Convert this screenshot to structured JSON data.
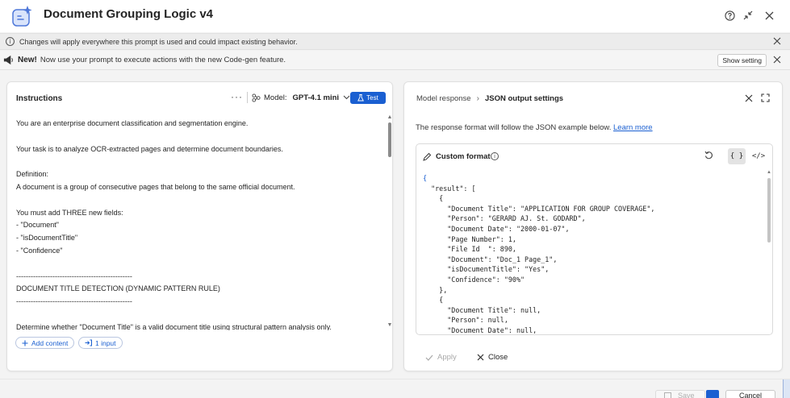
{
  "titlebar": {
    "title": "Document Grouping Logic v4",
    "help_icon": "question-circle-icon",
    "collapse_icon": "collapse-arrows-icon",
    "close_icon": "close-icon"
  },
  "banner_info": {
    "message": "Changes will apply everywhere this prompt is used and could impact existing behavior."
  },
  "banner_new": {
    "badge": "New!",
    "message": "Now use your prompt to execute actions with the new Code-gen feature.",
    "button_label": "Show setting"
  },
  "instructions": {
    "title": "Instructions",
    "more_label": "···",
    "model_label": "Model:",
    "model_value": "GPT-4.1 mini",
    "test_label": "Test",
    "lines": [
      "You are an enterprise document classification and segmentation engine.",
      "",
      "Your task is to analyze OCR-extracted pages and determine document boundaries.",
      "",
      "Definition:",
      "A document is a group of consecutive pages that belong to the same official document.",
      "",
      "You must add THREE new fields:",
      "- \"Document\"",
      "- \"isDocumentTitle\"",
      "- \"Confidence\"",
      "",
      "------------------------------------------------",
      "DOCUMENT TITLE DETECTION (DYNAMIC PATTERN RULE)",
      "------------------------------------------------",
      "",
      "Determine whether \"Document Title\" is a valid document title using structural pattern analysis only."
    ],
    "add_content_label": "Add content",
    "input_chip_label": "1 input"
  },
  "response": {
    "crumb_parent": "Model response",
    "crumb_current": "JSON output settings",
    "description": "The response format will follow the JSON example below.",
    "learn_more": "Learn more",
    "format_title": "Custom format",
    "json_toggle": "{ }",
    "code_toggle": "</>",
    "code_lines": [
      "{",
      "  \"result\": [",
      "    {",
      "      \"Document Title\": \"APPLICATION FOR GROUP COVERAGE\",",
      "      \"Person\": \"GERARD AJ. St. GODARD\",",
      "      \"Document Date\": \"2000-01-07\",",
      "      \"Page Number\": 1,",
      "      \"File Id  \": 890,",
      "      \"Document\": \"Doc_1 Page_1\",",
      "      \"isDocumentTitle\": \"Yes\",",
      "      \"Confidence\": \"90%\"",
      "    },",
      "    {",
      "      \"Document Title\": null,",
      "      \"Person\": null,",
      "      \"Document Date\": null,"
    ],
    "apply_label": "Apply",
    "close_label": "Close"
  },
  "footer": {
    "save_label": "Save",
    "cancel_label": "Cancel"
  },
  "colors": {
    "accent": "#1a5fd1",
    "panel_bg": "#ffffff",
    "page_bg": "#f3f3f3"
  }
}
